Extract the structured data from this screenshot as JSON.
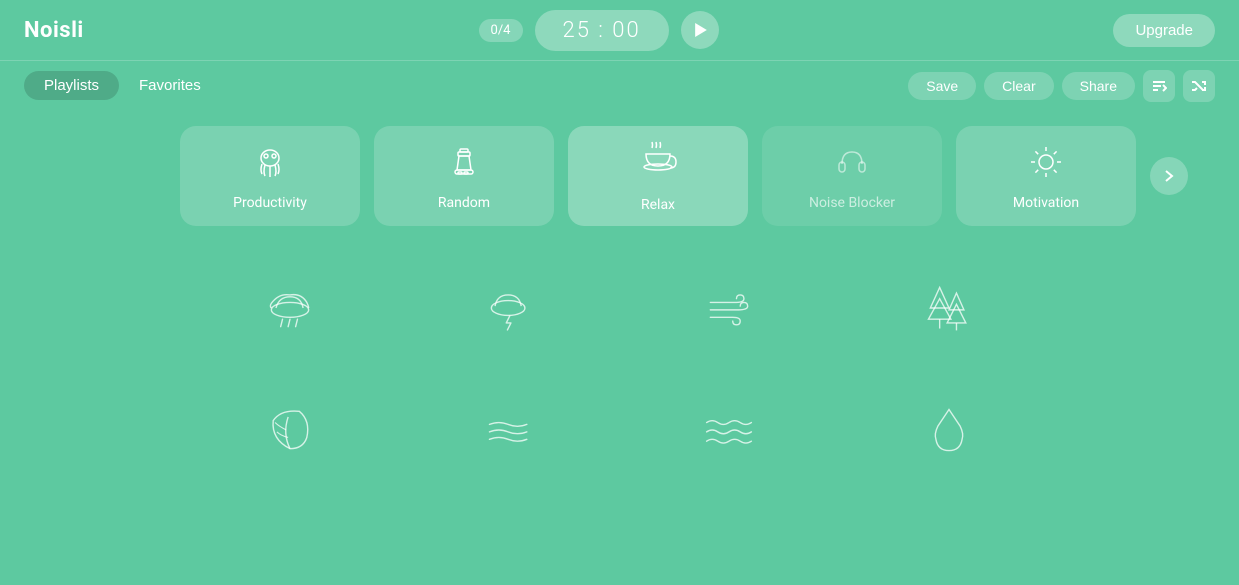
{
  "app": {
    "logo": "Noisli"
  },
  "header": {
    "timer_count": "0/4",
    "timer_display": "25 : 00",
    "play_label": "play",
    "upgrade_label": "Upgrade"
  },
  "sub_header": {
    "tabs": [
      {
        "id": "playlists",
        "label": "Playlists",
        "active": true
      },
      {
        "id": "favorites",
        "label": "Favorites",
        "active": false
      }
    ],
    "actions": [
      {
        "id": "save",
        "label": "Save"
      },
      {
        "id": "clear",
        "label": "Clear"
      },
      {
        "id": "share",
        "label": "Share"
      }
    ],
    "sort_icon": "↕",
    "shuffle_icon": "⇄"
  },
  "playlists": [
    {
      "id": "productivity",
      "label": "Productivity",
      "active": false
    },
    {
      "id": "random",
      "label": "Random",
      "active": false
    },
    {
      "id": "relax",
      "label": "Relax",
      "active": true
    },
    {
      "id": "noise-blocker",
      "label": "Noise Blocker",
      "active": false,
      "muted": true
    },
    {
      "id": "motivation",
      "label": "Motivation",
      "active": false
    }
  ],
  "sounds": [
    {
      "id": "rain",
      "label": "Rain"
    },
    {
      "id": "thunder",
      "label": "Thunder"
    },
    {
      "id": "wind",
      "label": "Wind"
    },
    {
      "id": "forest",
      "label": "Forest"
    },
    {
      "id": "leaf",
      "label": "Leaf"
    },
    {
      "id": "water-flow",
      "label": "Water Flow"
    },
    {
      "id": "waves",
      "label": "Waves"
    },
    {
      "id": "water-drop",
      "label": "Water Drop"
    }
  ]
}
